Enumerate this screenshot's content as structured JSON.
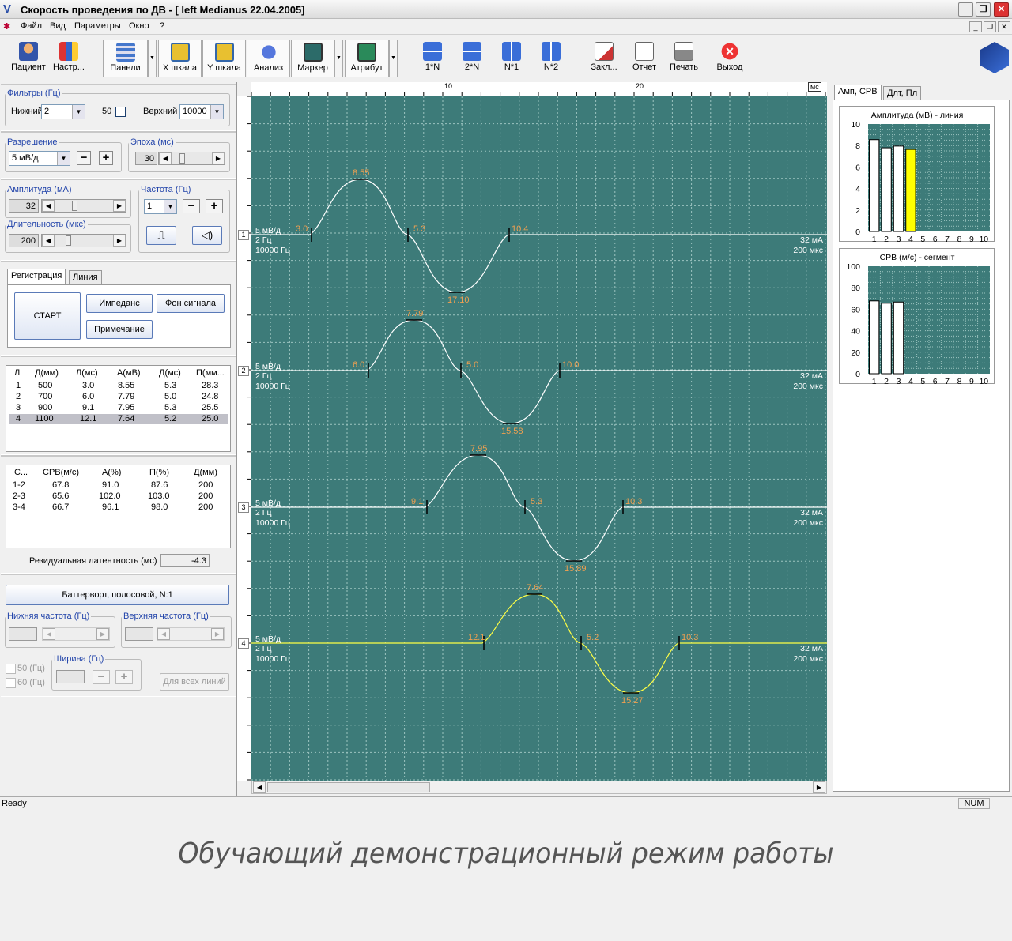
{
  "window": {
    "title": "Скорость проведения по ДВ - [ left Medianus 22.04.2005]"
  },
  "menu": [
    "Файл",
    "Вид",
    "Параметры",
    "Окно",
    "?"
  ],
  "toolbar": {
    "items": [
      "Пациент",
      "Настр...",
      "Панели",
      "X шкала",
      "Y шкала",
      "Анализ",
      "Маркер",
      "Атрибут",
      "1*N",
      "2*N",
      "N*1",
      "N*2",
      "Закл...",
      "Отчет",
      "Печать",
      "Выход"
    ]
  },
  "filters": {
    "legend": "Фильтры (Гц)",
    "low_label": "Нижний",
    "low": "2",
    "notch_label": "50",
    "high_label": "Верхний",
    "high": "10000"
  },
  "resolution": {
    "legend": "Разрешение",
    "value": "5 мВ/д",
    "minus": "−",
    "plus": "+"
  },
  "epoch": {
    "legend": "Эпоха (мс)",
    "value": "30"
  },
  "stim": {
    "amp_legend": "Амплитуда (мА)",
    "amp": "32",
    "freq_legend": "Частота (Гц)",
    "freq": "1",
    "dur_legend": "Длительность (мкс)",
    "dur": "200",
    "minus": "−",
    "plus": "+"
  },
  "reg": {
    "tabs": [
      "Регистрация",
      "Линия"
    ],
    "start": "СТАРТ",
    "impedance": "Импеданс",
    "background": "Фон сигнала",
    "note": "Примечание"
  },
  "table1": {
    "headers": [
      "Л",
      "Д(мм)",
      "Л(мс)",
      "А(мВ)",
      "Д(мс)",
      "П(мм..."
    ],
    "rows": [
      [
        "1",
        "500",
        "3.0",
        "8.55",
        "5.3",
        "28.3"
      ],
      [
        "2",
        "700",
        "6.0",
        "7.79",
        "5.0",
        "24.8"
      ],
      [
        "3",
        "900",
        "9.1",
        "7.95",
        "5.3",
        "25.5"
      ],
      [
        "4",
        "1100",
        "12.1",
        "7.64",
        "5.2",
        "25.0"
      ]
    ]
  },
  "table2": {
    "headers": [
      "С...",
      "СРВ(м/с)",
      "А(%)",
      "П(%)",
      "Д(мм)"
    ],
    "rows": [
      [
        "1-2",
        "67.8",
        "91.0",
        "87.6",
        "200"
      ],
      [
        "2-3",
        "65.6",
        "102.0",
        "103.0",
        "200"
      ],
      [
        "3-4",
        "66.7",
        "96.1",
        "98.0",
        "200"
      ]
    ]
  },
  "residual": {
    "label": "Резидуальная латентность (мс)",
    "value": "-4.3"
  },
  "filter2": {
    "button": "Баттерворт, полосовой, N:1",
    "low_legend": "Нижняя частота (Гц)",
    "high_legend": "Верхняя частота (Гц)",
    "f50": "50 (Гц)",
    "f60": "60 (Гц)",
    "width_legend": "Ширина (Гц)",
    "all_lines": "Для всех линий",
    "minus": "−",
    "plus": "+"
  },
  "ruler": {
    "ticks": [
      "10",
      "20"
    ],
    "unit": "мс"
  },
  "traces": [
    {
      "num": "1",
      "l1": "5 мВ/д",
      "l2": "2 Гц",
      "l3": "10000 Гц",
      "r1": "32 мА",
      "r2": "200 мкс",
      "m_start": "3.0",
      "m_peak": "8.55",
      "m_mid": "5.3",
      "m_trough": "17.10",
      "m_end": "10.4",
      "color": "#ffffff"
    },
    {
      "num": "2",
      "l1": "5 мВ/д",
      "l2": "2 Гц",
      "l3": "10000 Гц",
      "r1": "32 мА",
      "r2": "200 мкс",
      "m_start": "6.0",
      "m_peak": "7.79",
      "m_mid": "5.0",
      "m_trough": "15.58",
      "m_end": "10.0",
      "color": "#ffffff"
    },
    {
      "num": "3",
      "l1": "5 мВ/д",
      "l2": "2 Гц",
      "l3": "10000 Гц",
      "r1": "32 мА",
      "r2": "200 мкс",
      "m_start": "9.1",
      "m_peak": "7.95",
      "m_mid": "5.3",
      "m_trough": "15.89",
      "m_end": "10.3",
      "color": "#ffffff"
    },
    {
      "num": "4",
      "l1": "5 мВ/д",
      "l2": "2 Гц",
      "l3": "10000 Гц",
      "r1": "32 мА",
      "r2": "200 мкс",
      "m_start": "12.1",
      "m_peak": "7.64",
      "m_mid": "5.2",
      "m_trough": "15.27",
      "m_end": "10.3",
      "color": "#ffff44"
    }
  ],
  "right": {
    "tabs": [
      "Амп, СРВ",
      "Длт, Пл"
    ]
  },
  "chart_data": [
    {
      "type": "bar",
      "title": "Амплитуда (мВ) - линия",
      "categories": [
        "1",
        "2",
        "3",
        "4",
        "5",
        "6",
        "7",
        "8",
        "9",
        "10"
      ],
      "values": [
        8.55,
        7.79,
        7.95,
        7.64,
        null,
        null,
        null,
        null,
        null,
        null
      ],
      "ylim": [
        0,
        10
      ],
      "yticks": [
        "0",
        "2",
        "4",
        "6",
        "8",
        "10"
      ],
      "highlight_index": 3,
      "bar_color": "#ffffff",
      "highlight_color": "#ffff00",
      "bg": "#3d7b79"
    },
    {
      "type": "bar",
      "title": "СРВ (м/с) - сегмент",
      "categories": [
        "1",
        "2",
        "3",
        "4",
        "5",
        "6",
        "7",
        "8",
        "9",
        "10"
      ],
      "values": [
        67.8,
        65.6,
        66.7,
        null,
        null,
        null,
        null,
        null,
        null,
        null
      ],
      "ylim": [
        0,
        100
      ],
      "yticks": [
        "0",
        "20",
        "40",
        "60",
        "80",
        "100"
      ],
      "bar_color": "#ffffff",
      "bg": "#3d7b79"
    }
  ],
  "status": {
    "left": "Ready",
    "num": "NUM"
  },
  "caption": "Обучающий демонстрационный режим работы"
}
